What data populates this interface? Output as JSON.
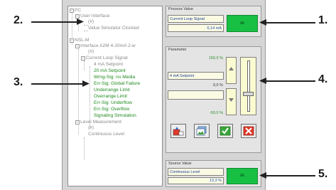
{
  "callouts": [
    {
      "number": "1.",
      "target": "process-value-ok-button"
    },
    {
      "number": "2.",
      "target": "tree-user-interface"
    },
    {
      "number": "3.",
      "target": "tree-current-loop-signal"
    },
    {
      "number": "4.",
      "target": "parameter-panel"
    },
    {
      "number": "5.",
      "target": "source-value-ok-button"
    }
  ],
  "tree": {
    "root": "PC",
    "user_interface": "User Interface",
    "ui_hash": "(#)",
    "value_simulator": "Value Simulator Clocked",
    "nsl": "NSL-M",
    "interface": "Interface A2M 4-20mA 2-w",
    "if_hash": "(#)",
    "current_loop": "Current Loop Signal",
    "items": [
      {
        "label": "4 mA Setpoint",
        "green": false
      },
      {
        "label": "20 mA Setpoint",
        "green": true
      },
      {
        "label": "Wrng-Sig: no Media",
        "green": true
      },
      {
        "label": "Err-Sig: Global Failure",
        "green": true
      },
      {
        "label": "Underrange Limit",
        "green": true
      },
      {
        "label": "Overrange Limit",
        "green": true
      },
      {
        "label": "Err-Sig: Underflow",
        "green": true
      },
      {
        "label": "Err-Sig: Overflow",
        "green": true
      },
      {
        "label": "Signaling Simulation",
        "green": true
      }
    ],
    "level_measurement": "Level Measurement",
    "lm_hash": "(#)",
    "continuous_level": "Continuous Level"
  },
  "process_value": {
    "title": "Process Value",
    "signal_name": "Current Loop Signal",
    "value": "6,14 mA",
    "ok_label": "ok"
  },
  "parameter": {
    "title": "Parameter",
    "max_pct": "150,0 %",
    "name": "4 mA Setpoint",
    "current_pct": "0,0 %",
    "min_pct": "-50,0 %",
    "slider_level": 0.33,
    "up_icon": "triangle-up",
    "down_icon": "triangle-down"
  },
  "toolbar": {
    "icons": [
      "reset-icon",
      "image-icon",
      "check-icon",
      "close-icon"
    ]
  },
  "source_value": {
    "title": "Source Value",
    "name": "Continuous Level",
    "value": "13,3 %",
    "ok_label": "ok"
  },
  "colors": {
    "ok_green": "#17c043",
    "tree_green": "#1f8a1f",
    "value_blue": "#1e4fb3",
    "field_bg": "#fbfbe4",
    "close_red": "#e03a2a"
  }
}
